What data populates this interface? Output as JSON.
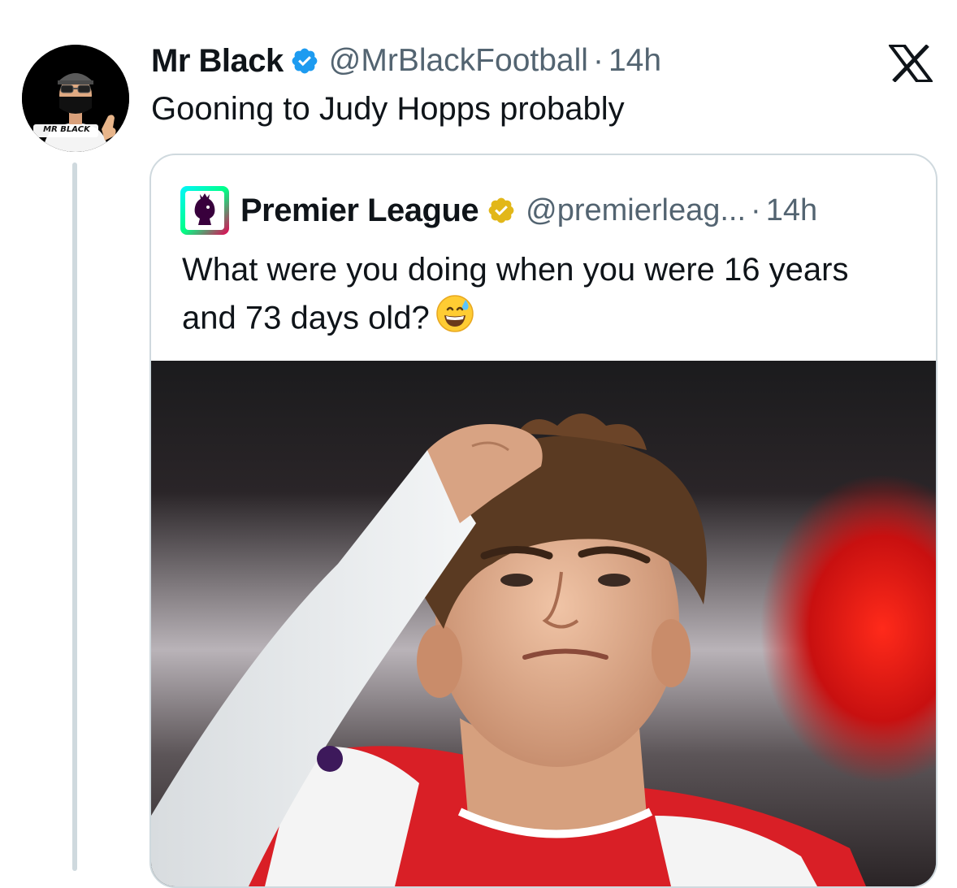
{
  "tweet": {
    "author": {
      "display_name": "Mr Black",
      "handle": "@MrBlackFootball",
      "avatar_caption": "MR BLACK",
      "verified_color": "#1d9bf0"
    },
    "separator": "·",
    "timestamp": "14h",
    "text": "Gooning to Judy Hopps probably"
  },
  "quoted_tweet": {
    "author": {
      "display_name": "Premier League",
      "handle": "@premierleag...",
      "verified_color": "#e2b719"
    },
    "separator": "·",
    "timestamp": "14h",
    "text": "What were you doing when you were 16 years and 73 days old?",
    "emoji": "grinning-face-with-sweat",
    "media": {
      "type": "photo",
      "alt": ""
    }
  },
  "icons": {
    "x_logo": "x-logo-icon",
    "verified": "verified-badge-icon"
  },
  "colors": {
    "primary_text": "#0f1419",
    "secondary_text": "#536471",
    "border": "#cfd9de"
  }
}
